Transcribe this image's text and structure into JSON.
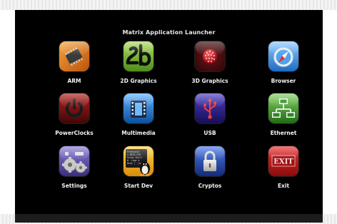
{
  "window": {
    "title": "Matrix Application Launcher"
  },
  "apps": [
    {
      "id": "arm",
      "label": "ARM",
      "icon": "arm-chip-icon",
      "color": "#e07a1c"
    },
    {
      "id": "2d-graphics",
      "label": "2D Graphics",
      "icon": "2d-graphics-icon",
      "color": "#6fb02c"
    },
    {
      "id": "3d-graphics",
      "label": "3D Graphics",
      "icon": "3d-sphere-icon",
      "color": "#5a0f12"
    },
    {
      "id": "browser",
      "label": "Browser",
      "icon": "compass-icon",
      "color": "#3b8fd6"
    },
    {
      "id": "powerclocks",
      "label": "PowerClocks",
      "icon": "power-icon",
      "color": "#7a1414"
    },
    {
      "id": "multimedia",
      "label": "Multimedia",
      "icon": "film-icon",
      "color": "#1e6bbf"
    },
    {
      "id": "usb",
      "label": "USB",
      "icon": "usb-icon",
      "color": "#2a1f8a"
    },
    {
      "id": "ethernet",
      "label": "Ethernet",
      "icon": "network-icon",
      "color": "#3b8a2b"
    },
    {
      "id": "settings",
      "label": "Settings",
      "icon": "gears-icon",
      "color": "#5a4a9e"
    },
    {
      "id": "start-dev",
      "label": "Start Dev",
      "icon": "terminal-penguin-icon",
      "color": "#e8a416"
    },
    {
      "id": "cryptos",
      "label": "Cryptos",
      "icon": "lock-icon",
      "color": "#1e3f9e"
    },
    {
      "id": "exit",
      "label": "Exit",
      "icon": "exit-sign-icon",
      "color": "#c21818"
    }
  ],
  "terminal_icon_text": [
    "Freescale",
    "i.MX28 EVK",
    "Linux Shell",
    "# ./app &",
    "#cat | ./a"
  ],
  "exit_icon_text": "EXIT"
}
